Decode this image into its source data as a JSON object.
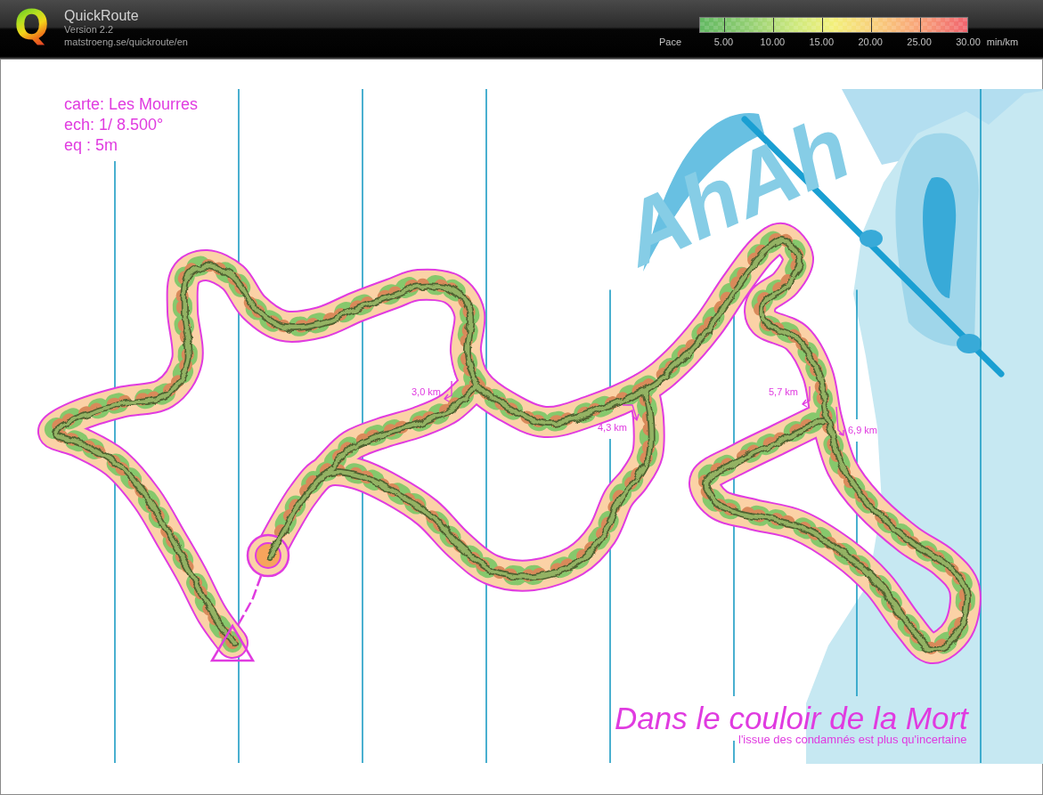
{
  "header": {
    "logo": "Q",
    "title": "QuickRoute",
    "version": "Version 2.2",
    "url": "matstroeng.se/quickroute/en"
  },
  "pace_legend": {
    "label": "Pace",
    "ticks": [
      "5.00",
      "10.00",
      "15.00",
      "20.00",
      "25.00",
      "30.00"
    ],
    "unit": "min/km"
  },
  "map": {
    "info": [
      "carte: Les Mourres",
      "ech: 1/ 8.500°",
      "eq : 5m"
    ],
    "artwork_text": "AhAh",
    "distance_marks": [
      "3,0 km",
      "4,3 km",
      "5,7 km",
      "6,9 km"
    ],
    "title": "Dans le couloir de la Mort",
    "subtitle": "l'issue des condamnés est plus qu'incertaine"
  }
}
